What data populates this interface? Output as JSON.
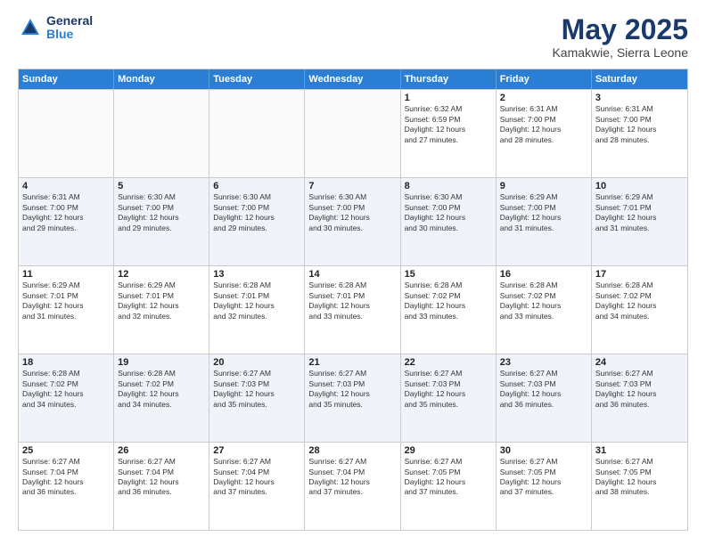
{
  "header": {
    "logo_general": "General",
    "logo_blue": "Blue",
    "month": "May 2025",
    "location": "Kamakwie, Sierra Leone"
  },
  "weekdays": [
    "Sunday",
    "Monday",
    "Tuesday",
    "Wednesday",
    "Thursday",
    "Friday",
    "Saturday"
  ],
  "rows": [
    [
      {
        "day": "",
        "info": "",
        "empty": true
      },
      {
        "day": "",
        "info": "",
        "empty": true
      },
      {
        "day": "",
        "info": "",
        "empty": true
      },
      {
        "day": "",
        "info": "",
        "empty": true
      },
      {
        "day": "1",
        "info": "Sunrise: 6:32 AM\nSunset: 6:59 PM\nDaylight: 12 hours\nand 27 minutes.",
        "empty": false
      },
      {
        "day": "2",
        "info": "Sunrise: 6:31 AM\nSunset: 7:00 PM\nDaylight: 12 hours\nand 28 minutes.",
        "empty": false
      },
      {
        "day": "3",
        "info": "Sunrise: 6:31 AM\nSunset: 7:00 PM\nDaylight: 12 hours\nand 28 minutes.",
        "empty": false
      }
    ],
    [
      {
        "day": "4",
        "info": "Sunrise: 6:31 AM\nSunset: 7:00 PM\nDaylight: 12 hours\nand 29 minutes.",
        "empty": false
      },
      {
        "day": "5",
        "info": "Sunrise: 6:30 AM\nSunset: 7:00 PM\nDaylight: 12 hours\nand 29 minutes.",
        "empty": false
      },
      {
        "day": "6",
        "info": "Sunrise: 6:30 AM\nSunset: 7:00 PM\nDaylight: 12 hours\nand 29 minutes.",
        "empty": false
      },
      {
        "day": "7",
        "info": "Sunrise: 6:30 AM\nSunset: 7:00 PM\nDaylight: 12 hours\nand 30 minutes.",
        "empty": false
      },
      {
        "day": "8",
        "info": "Sunrise: 6:30 AM\nSunset: 7:00 PM\nDaylight: 12 hours\nand 30 minutes.",
        "empty": false
      },
      {
        "day": "9",
        "info": "Sunrise: 6:29 AM\nSunset: 7:00 PM\nDaylight: 12 hours\nand 31 minutes.",
        "empty": false
      },
      {
        "day": "10",
        "info": "Sunrise: 6:29 AM\nSunset: 7:01 PM\nDaylight: 12 hours\nand 31 minutes.",
        "empty": false
      }
    ],
    [
      {
        "day": "11",
        "info": "Sunrise: 6:29 AM\nSunset: 7:01 PM\nDaylight: 12 hours\nand 31 minutes.",
        "empty": false
      },
      {
        "day": "12",
        "info": "Sunrise: 6:29 AM\nSunset: 7:01 PM\nDaylight: 12 hours\nand 32 minutes.",
        "empty": false
      },
      {
        "day": "13",
        "info": "Sunrise: 6:28 AM\nSunset: 7:01 PM\nDaylight: 12 hours\nand 32 minutes.",
        "empty": false
      },
      {
        "day": "14",
        "info": "Sunrise: 6:28 AM\nSunset: 7:01 PM\nDaylight: 12 hours\nand 33 minutes.",
        "empty": false
      },
      {
        "day": "15",
        "info": "Sunrise: 6:28 AM\nSunset: 7:02 PM\nDaylight: 12 hours\nand 33 minutes.",
        "empty": false
      },
      {
        "day": "16",
        "info": "Sunrise: 6:28 AM\nSunset: 7:02 PM\nDaylight: 12 hours\nand 33 minutes.",
        "empty": false
      },
      {
        "day": "17",
        "info": "Sunrise: 6:28 AM\nSunset: 7:02 PM\nDaylight: 12 hours\nand 34 minutes.",
        "empty": false
      }
    ],
    [
      {
        "day": "18",
        "info": "Sunrise: 6:28 AM\nSunset: 7:02 PM\nDaylight: 12 hours\nand 34 minutes.",
        "empty": false
      },
      {
        "day": "19",
        "info": "Sunrise: 6:28 AM\nSunset: 7:02 PM\nDaylight: 12 hours\nand 34 minutes.",
        "empty": false
      },
      {
        "day": "20",
        "info": "Sunrise: 6:27 AM\nSunset: 7:03 PM\nDaylight: 12 hours\nand 35 minutes.",
        "empty": false
      },
      {
        "day": "21",
        "info": "Sunrise: 6:27 AM\nSunset: 7:03 PM\nDaylight: 12 hours\nand 35 minutes.",
        "empty": false
      },
      {
        "day": "22",
        "info": "Sunrise: 6:27 AM\nSunset: 7:03 PM\nDaylight: 12 hours\nand 35 minutes.",
        "empty": false
      },
      {
        "day": "23",
        "info": "Sunrise: 6:27 AM\nSunset: 7:03 PM\nDaylight: 12 hours\nand 36 minutes.",
        "empty": false
      },
      {
        "day": "24",
        "info": "Sunrise: 6:27 AM\nSunset: 7:03 PM\nDaylight: 12 hours\nand 36 minutes.",
        "empty": false
      }
    ],
    [
      {
        "day": "25",
        "info": "Sunrise: 6:27 AM\nSunset: 7:04 PM\nDaylight: 12 hours\nand 36 minutes.",
        "empty": false
      },
      {
        "day": "26",
        "info": "Sunrise: 6:27 AM\nSunset: 7:04 PM\nDaylight: 12 hours\nand 36 minutes.",
        "empty": false
      },
      {
        "day": "27",
        "info": "Sunrise: 6:27 AM\nSunset: 7:04 PM\nDaylight: 12 hours\nand 37 minutes.",
        "empty": false
      },
      {
        "day": "28",
        "info": "Sunrise: 6:27 AM\nSunset: 7:04 PM\nDaylight: 12 hours\nand 37 minutes.",
        "empty": false
      },
      {
        "day": "29",
        "info": "Sunrise: 6:27 AM\nSunset: 7:05 PM\nDaylight: 12 hours\nand 37 minutes.",
        "empty": false
      },
      {
        "day": "30",
        "info": "Sunrise: 6:27 AM\nSunset: 7:05 PM\nDaylight: 12 hours\nand 37 minutes.",
        "empty": false
      },
      {
        "day": "31",
        "info": "Sunrise: 6:27 AM\nSunset: 7:05 PM\nDaylight: 12 hours\nand 38 minutes.",
        "empty": false
      }
    ]
  ]
}
